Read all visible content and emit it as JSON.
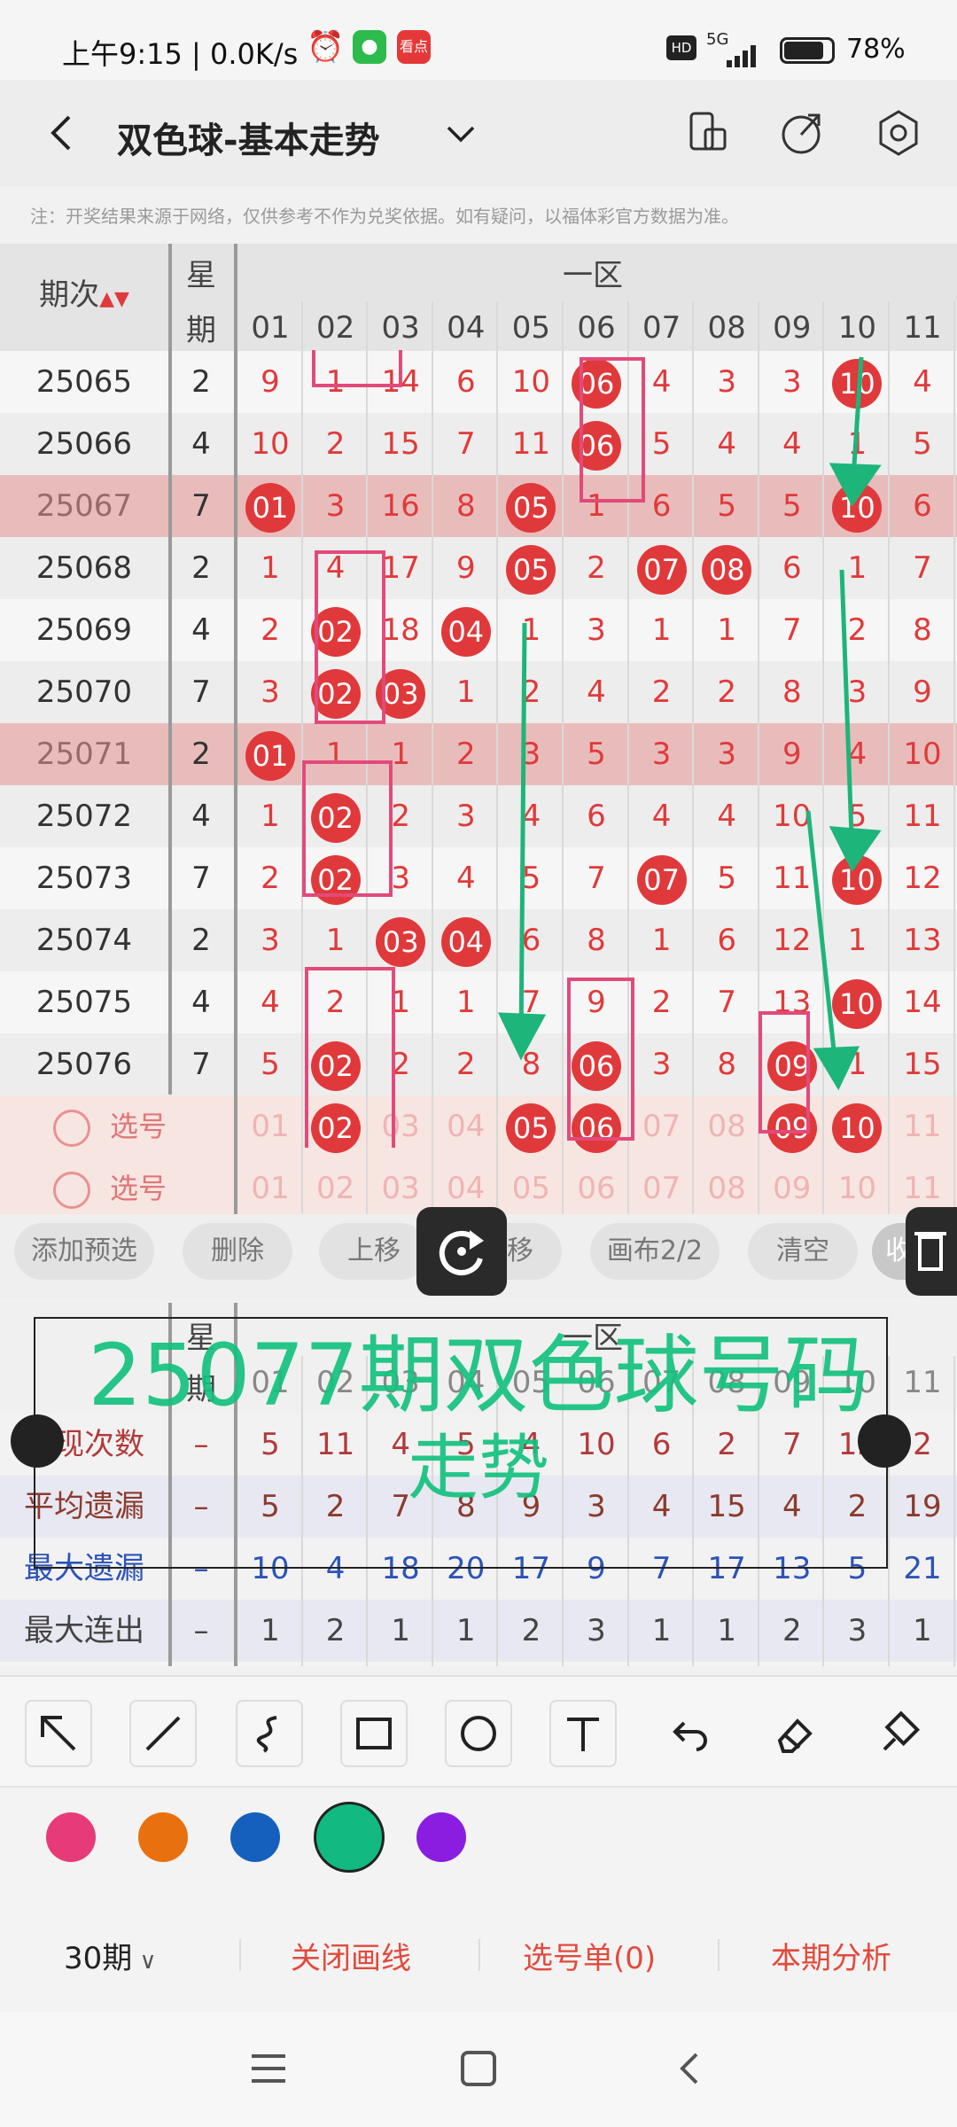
{
  "status": {
    "time": "上午9:15 | 0.0K/s",
    "battery": "78%",
    "net": "5G"
  },
  "header": {
    "title": "双色球-基本走势",
    "note": "注：开奖结果来源于网络，仅供参考不作为兑奖依据。如有疑问，以福体彩官方数据为准。"
  },
  "grid": {
    "period_header": "期次",
    "week_header_1": "星",
    "week_header_2": "期",
    "zone_header": "一区",
    "columns": [
      "01",
      "02",
      "03",
      "04",
      "05",
      "06",
      "07",
      "08",
      "09",
      "10",
      "11"
    ],
    "rows": [
      {
        "period": "25065",
        "week": "2",
        "vals": [
          "9",
          "1",
          "14",
          "6",
          "10",
          "06",
          "4",
          "3",
          "3",
          "10",
          "4"
        ],
        "hit": [
          5,
          9
        ]
      },
      {
        "period": "25066",
        "week": "4",
        "vals": [
          "10",
          "2",
          "15",
          "7",
          "11",
          "06",
          "5",
          "4",
          "4",
          "1",
          "5"
        ],
        "hit": [
          5
        ]
      },
      {
        "period": "25067",
        "week": "7",
        "vals": [
          "01",
          "3",
          "16",
          "8",
          "05",
          "1",
          "6",
          "5",
          "5",
          "10",
          "6"
        ],
        "hit": [
          0,
          4,
          9
        ]
      },
      {
        "period": "25068",
        "week": "2",
        "vals": [
          "1",
          "4",
          "17",
          "9",
          "05",
          "2",
          "07",
          "08",
          "6",
          "1",
          "7"
        ],
        "hit": [
          4,
          6,
          7
        ]
      },
      {
        "period": "25069",
        "week": "4",
        "vals": [
          "2",
          "02",
          "18",
          "04",
          "1",
          "3",
          "1",
          "1",
          "7",
          "2",
          "8"
        ],
        "hit": [
          1,
          3
        ]
      },
      {
        "period": "25070",
        "week": "7",
        "vals": [
          "3",
          "02",
          "03",
          "1",
          "2",
          "4",
          "2",
          "2",
          "8",
          "3",
          "9"
        ],
        "hit": [
          1,
          2
        ]
      },
      {
        "period": "25071",
        "week": "2",
        "vals": [
          "01",
          "1",
          "1",
          "2",
          "3",
          "5",
          "3",
          "3",
          "9",
          "4",
          "10"
        ],
        "hit": [
          0
        ]
      },
      {
        "period": "25072",
        "week": "4",
        "vals": [
          "1",
          "02",
          "2",
          "3",
          "4",
          "6",
          "4",
          "4",
          "10",
          "5",
          "11"
        ],
        "hit": [
          1
        ]
      },
      {
        "period": "25073",
        "week": "7",
        "vals": [
          "2",
          "02",
          "3",
          "4",
          "5",
          "7",
          "07",
          "5",
          "11",
          "10",
          "12"
        ],
        "hit": [
          1,
          6,
          9
        ]
      },
      {
        "period": "25074",
        "week": "2",
        "vals": [
          "3",
          "1",
          "03",
          "04",
          "6",
          "8",
          "1",
          "6",
          "12",
          "1",
          "13"
        ],
        "hit": [
          2,
          3
        ]
      },
      {
        "period": "25075",
        "week": "4",
        "vals": [
          "4",
          "2",
          "1",
          "1",
          "7",
          "9",
          "2",
          "7",
          "13",
          "10",
          "14"
        ],
        "hit": [
          9
        ]
      },
      {
        "period": "25076",
        "week": "7",
        "vals": [
          "5",
          "02",
          "2",
          "2",
          "8",
          "06",
          "3",
          "8",
          "09",
          "1",
          "15"
        ],
        "hit": [
          1,
          5,
          8
        ]
      }
    ],
    "select_rows": [
      {
        "label": "选号",
        "vals": [
          "01",
          "02",
          "03",
          "04",
          "05",
          "06",
          "07",
          "08",
          "09",
          "10",
          "11"
        ],
        "hit": [
          1,
          4,
          5,
          8,
          9
        ]
      },
      {
        "label": "选号",
        "vals": [
          "01",
          "02",
          "03",
          "04",
          "05",
          "06",
          "07",
          "08",
          "09",
          "10",
          "11"
        ],
        "hit": []
      }
    ]
  },
  "actions": [
    "添加预选",
    "删除",
    "上移",
    "下移",
    "画布2/2",
    "清空",
    "收起"
  ],
  "overlay_text_1": "25077期双色球号码",
  "overlay_text_2": "走势",
  "stats": {
    "week_header_1": "星",
    "week_header_2": "期",
    "zone_header": "一区",
    "columns": [
      "01",
      "02",
      "03",
      "04",
      "05",
      "06",
      "07",
      "08",
      "09",
      "10",
      "11"
    ],
    "rows": [
      {
        "label": "出现次数",
        "dash": "–",
        "vals": [
          "5",
          "11",
          "4",
          "5",
          "4",
          "10",
          "6",
          "2",
          "7",
          "12",
          "2"
        ],
        "color": "#b23a3a"
      },
      {
        "label": "平均遗漏",
        "dash": "–",
        "vals": [
          "5",
          "2",
          "7",
          "8",
          "9",
          "3",
          "4",
          "15",
          "4",
          "2",
          "19"
        ],
        "color": "#8a3b2c"
      },
      {
        "label": "最大遗漏",
        "dash": "–",
        "vals": [
          "10",
          "4",
          "18",
          "20",
          "17",
          "9",
          "7",
          "17",
          "13",
          "5",
          "21"
        ],
        "color": "#2c53b8"
      },
      {
        "label": "最大连出",
        "dash": "–",
        "vals": [
          "1",
          "2",
          "1",
          "1",
          "2",
          "3",
          "1",
          "1",
          "2",
          "3",
          "1"
        ],
        "color": "#444"
      }
    ]
  },
  "tools": [
    "arrow-tool",
    "line-tool",
    "freehand-tool",
    "rect-tool",
    "circle-tool",
    "text-tool",
    "undo-tool",
    "eraser-tool",
    "clear-tool"
  ],
  "colors": [
    "#e63b78",
    "#e9700f",
    "#1560bd",
    "#12b981",
    "#8a1de0"
  ],
  "bottom": {
    "period_select": "30期",
    "close_line": "关闭画线",
    "pick_list": "选号单(0)",
    "analysis": "本期分析"
  }
}
